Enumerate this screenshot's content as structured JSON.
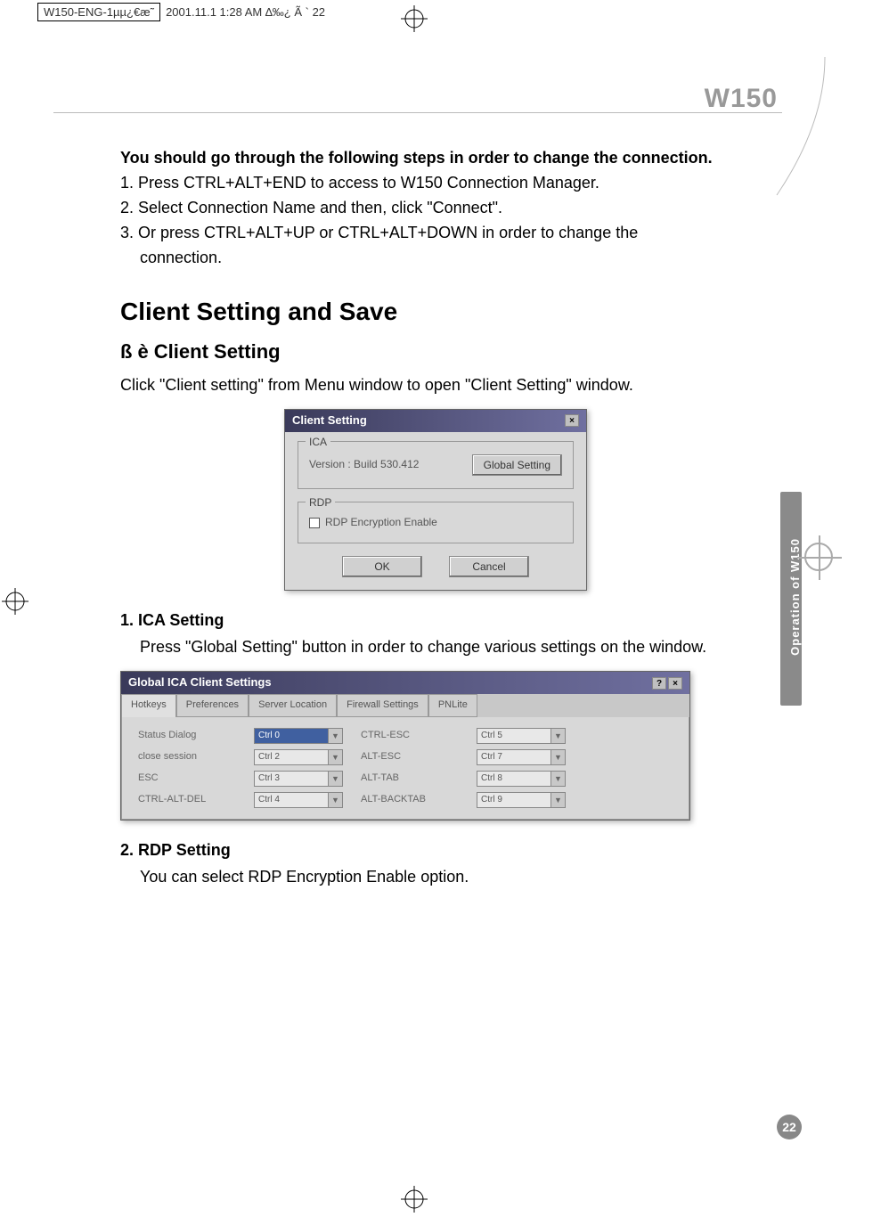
{
  "print_header": {
    "text1": "W150-ENG-1µµ¿€æ˜",
    "text2": "2001.11.1 1:28 AM ∆‰¿   Ã  ` 22"
  },
  "model": "W150",
  "sidebar_text": "Operation of W150",
  "page_number": "22",
  "intro": {
    "heading": "You should go through the following steps in order to change the connection.",
    "step1": "1. Press CTRL+ALT+END to access to W150 Connection Manager.",
    "step2": "2. Select Connection Name and then, click \"Connect\".",
    "step3": "3. Or press CTRL+ALT+UP or CTRL+ALT+DOWN in order to change the",
    "step3b": "connection."
  },
  "section": {
    "h2": "Client Setting and Save",
    "bullet": "ß è",
    "h3": "Client Setting",
    "desc": "Click \"Client setting\" from Menu window to open \"Client Setting\" window."
  },
  "dialog1": {
    "title": "Client Setting",
    "ica_label": "ICA",
    "version": "Version :  Build 530.412",
    "global_btn": "Global Setting",
    "rdp_label": "RDP",
    "rdp_check": "RDP Encryption Enable",
    "ok": "OK",
    "cancel": "Cancel"
  },
  "ica": {
    "heading": "1. ICA Setting",
    "desc": "Press \"Global Setting\" button in order to change various settings on the window."
  },
  "dialog2": {
    "title": "Global ICA Client Settings",
    "tabs": [
      "Hotkeys",
      "Preferences",
      "Server Location",
      "Firewall Settings",
      "PNLite"
    ],
    "rows": [
      {
        "l1": "Status Dialog",
        "v1": "Ctrl 0",
        "sel": true,
        "l2": "CTRL-ESC",
        "v2": "Ctrl 5"
      },
      {
        "l1": "close session",
        "v1": "Ctrl 2",
        "sel": false,
        "l2": "ALT-ESC",
        "v2": "Ctrl 7"
      },
      {
        "l1": "ESC",
        "v1": "Ctrl 3",
        "sel": false,
        "l2": "ALT-TAB",
        "v2": "Ctrl 8"
      },
      {
        "l1": "CTRL-ALT-DEL",
        "v1": "Ctrl 4",
        "sel": false,
        "l2": "ALT-BACKTAB",
        "v2": "Ctrl 9"
      }
    ]
  },
  "rdp": {
    "heading": "2. RDP Setting",
    "desc": "You can select RDP Encryption Enable option."
  }
}
